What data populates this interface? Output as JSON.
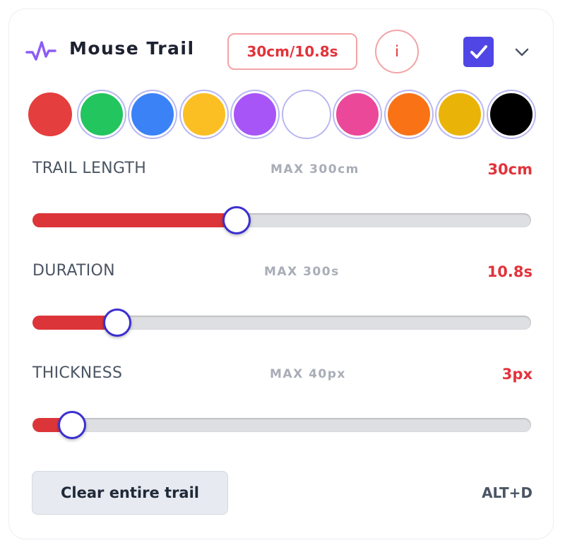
{
  "header": {
    "title": "Mouse Trail",
    "summary": "30cm/10.8s",
    "info_label": "i",
    "enabled": true,
    "icon": "pulse-icon",
    "accent": "#8b5cf6"
  },
  "colors": [
    {
      "name": "red",
      "hex": "#e53e3e",
      "selected": true
    },
    {
      "name": "green",
      "hex": "#22c55e",
      "selected": false
    },
    {
      "name": "blue",
      "hex": "#3b82f6",
      "selected": false
    },
    {
      "name": "amber",
      "hex": "#fbbf24",
      "selected": false
    },
    {
      "name": "purple",
      "hex": "#a855f7",
      "selected": false
    },
    {
      "name": "white",
      "hex": "#ffffff",
      "selected": false
    },
    {
      "name": "pink",
      "hex": "#ec4899",
      "selected": false
    },
    {
      "name": "orange",
      "hex": "#f97316",
      "selected": false
    },
    {
      "name": "gold",
      "hex": "#eab308",
      "selected": false
    },
    {
      "name": "black",
      "hex": "#000000",
      "selected": false
    }
  ],
  "sliders": {
    "trail_length": {
      "label": "TRAIL LENGTH",
      "max": "MAX 300cm",
      "value": "30cm",
      "fraction": 0.41
    },
    "duration": {
      "label": "DURATION",
      "max": "MAX 300s",
      "value": "10.8s",
      "fraction": 0.17
    },
    "thickness": {
      "label": "THICKNESS",
      "max": "MAX 40px",
      "value": "3px",
      "fraction": 0.08
    }
  },
  "footer": {
    "clear_label": "Clear entire trail",
    "shortcut": "ALT+D"
  },
  "theme": {
    "value_color": "#e2333b",
    "slider_fill": "#dc3539",
    "knob_border": "#3b2fd0",
    "checkbox": "#4f46e5"
  }
}
